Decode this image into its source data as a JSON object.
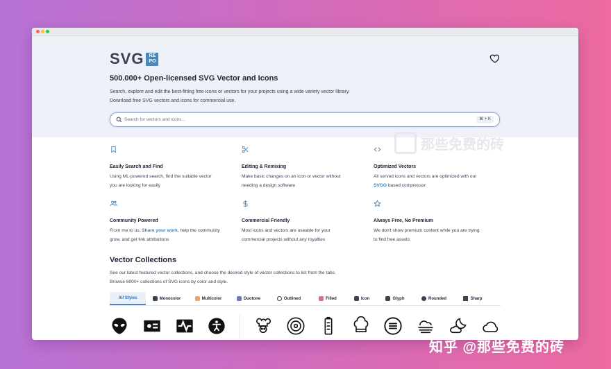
{
  "header": {
    "logo_text": "SVG",
    "logo_badge": [
      "RE",
      "PO"
    ],
    "title": "500.000+ Open-licensed SVG Vector and Icons",
    "description_line1": "Search, explore and edit the best-fitting free icons or vectors for your projects using a wide variety vector library.",
    "description_line2": "Download free SVG vectors and icons for commercial use."
  },
  "search": {
    "placeholder": "Search for vectors and icons...",
    "shortcut": "⌘ + K"
  },
  "watermark": {
    "top_text": "那些免费的砖",
    "bottom_text": "知乎 @那些免费的砖"
  },
  "features": [
    {
      "title": "Easily Search and Find",
      "line1": "Using ML-powered search, find the suitable vector",
      "line2": "you are looking for easily",
      "icon": "bookmark-icon"
    },
    {
      "title": "Editing & Remixing",
      "line1": "Make basic changes on an icon or vector without",
      "line2": "needing a design software",
      "icon": "scissors-icon"
    },
    {
      "title": "Optimized Vectors",
      "line1": "All served icons and vectors are optimized with our",
      "line2_link": "SVGO",
      "line2_rest": " based compressor",
      "icon": "code-icon"
    },
    {
      "title": "Community Powered",
      "line1_pre": "From me to us. ",
      "line1_link": "Share your work",
      "line1_post": ", help the community",
      "line2": "grow, and get link attributions",
      "icon": "users-icon"
    },
    {
      "title": "Commercial Friendly",
      "line1": "Most icons and vectors are useable for your",
      "line2": "commercial projects without any royalties",
      "icon": "dollar-icon"
    },
    {
      "title": "Always Free, No Premium",
      "line1": "We don't show premium content while you are trying",
      "line2": "to find free assets",
      "icon": "star-icon"
    }
  ],
  "collections": {
    "title": "Vector Collections",
    "desc_line1": "See our latest featured vector collections, and choose the desired style of vector collections to list from the tabs.",
    "desc_line2": "Browse 6000+ collections of SVG icons by color and style.",
    "tabs": [
      {
        "label": "All Styles",
        "color": "#4f86b6"
      },
      {
        "label": "Monocolor",
        "color": "#3b4256"
      },
      {
        "label": "Multicolor",
        "color": "#f0a35a"
      },
      {
        "label": "Duotone",
        "color": "#6a79c4"
      },
      {
        "label": "Outlined",
        "color": "#3b4256"
      },
      {
        "label": "Filled",
        "color": "#e06b8a"
      },
      {
        "label": "Icon",
        "color": "#3b4256"
      },
      {
        "label": "Glyph",
        "color": "#3b4256"
      },
      {
        "label": "Rounded",
        "color": "#3b4256"
      },
      {
        "label": "Sharp",
        "color": "#3b4256"
      }
    ]
  },
  "colors": {
    "accent": "#4f86b6",
    "link": "#2f87c9",
    "hero_bg": "#eef1f7",
    "text": "#1e2433"
  }
}
